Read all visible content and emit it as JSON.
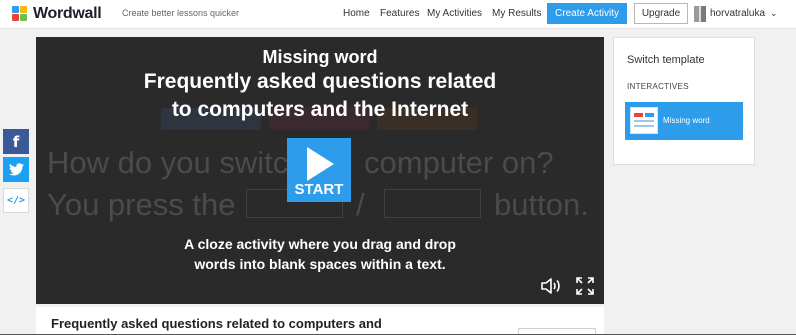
{
  "header": {
    "logo_text": "Wordwall",
    "tagline": "Create better lessons quicker",
    "nav": [
      {
        "label": "Home"
      },
      {
        "label": "Features"
      },
      {
        "label": "My Activities"
      },
      {
        "label": "My Results"
      }
    ],
    "create_label": "Create Activity",
    "upgrade_label": "Upgrade",
    "username": "horvatraluka",
    "icons": {
      "logo": "wordwall-logo-icon",
      "avatar": "user-avatar",
      "dropdown": "chevron-down-icon"
    }
  },
  "share": [
    {
      "name": "facebook-icon",
      "glyph": "f",
      "color": "#3b5998"
    },
    {
      "name": "twitter-icon",
      "glyph": "🐦",
      "color": "#1da1f2"
    },
    {
      "name": "embed-icon",
      "glyph": "</>",
      "color": "#ffffff"
    }
  ],
  "player": {
    "template_name": "Missing word",
    "title_line1": "Frequently asked questions related",
    "title_line2": "to computers and the Internet",
    "bg_line1": "How do you switc",
    "bg_line1_end": "computer on?",
    "bg_line2_start": "You press the",
    "bg_line2_slash": "/",
    "bg_line2_end": "button.",
    "start_label": "START",
    "desc_line1": "A cloze activity where you drag and drop",
    "desc_line2": "words into blank spaces within a text.",
    "colors": {
      "background": "#2a2a2a",
      "accent": "#2d9cea"
    },
    "icons": {
      "play": "play-icon",
      "sound": "sound-icon",
      "fullscreen": "fullscreen-icon"
    }
  },
  "sidebar": {
    "title": "Switch template",
    "section": "INTERACTIVES",
    "templates": [
      {
        "label": "Missing word"
      }
    ]
  },
  "below": {
    "title": "Frequently asked questions related to computers and"
  }
}
